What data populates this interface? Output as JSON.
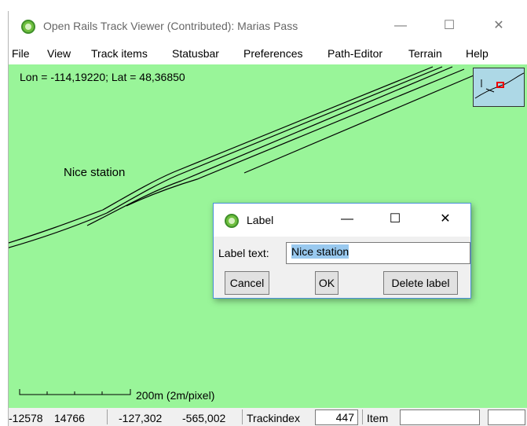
{
  "window": {
    "title": "Open Rails Track Viewer (Contributed): Marias Pass",
    "minimize_glyph": "—",
    "maximize_glyph": "☐",
    "close_glyph": "✕"
  },
  "menu": {
    "items": [
      "File",
      "View",
      "Track items",
      "Statusbar",
      "Preferences",
      "Path-Editor",
      "Terrain",
      "Help"
    ]
  },
  "canvas": {
    "coords": "Lon = -114,19220; Lat = 48,36850",
    "label": "Nice station",
    "scale_label": "200m (2m/pixel)",
    "background_color": "#99f599"
  },
  "statusbar": {
    "tile_x": "-12578",
    "tile_z": "14766",
    "x": "-127,302",
    "z": "-565,002",
    "trackindex_label": "Trackindex",
    "trackindex_value": "447",
    "item_label": "Item",
    "item_value": "",
    "extra_value": ""
  },
  "dialog": {
    "title": "Label",
    "minimize_glyph": "—",
    "maximize_glyph": "☐",
    "close_glyph": "✕",
    "field_label": "Label text:",
    "field_value": "Nice station",
    "cancel_label": "Cancel",
    "ok_label": "OK",
    "delete_label": "Delete label"
  },
  "icons": {
    "app": "open-rails-icon",
    "minimap": "minimap-icon"
  }
}
